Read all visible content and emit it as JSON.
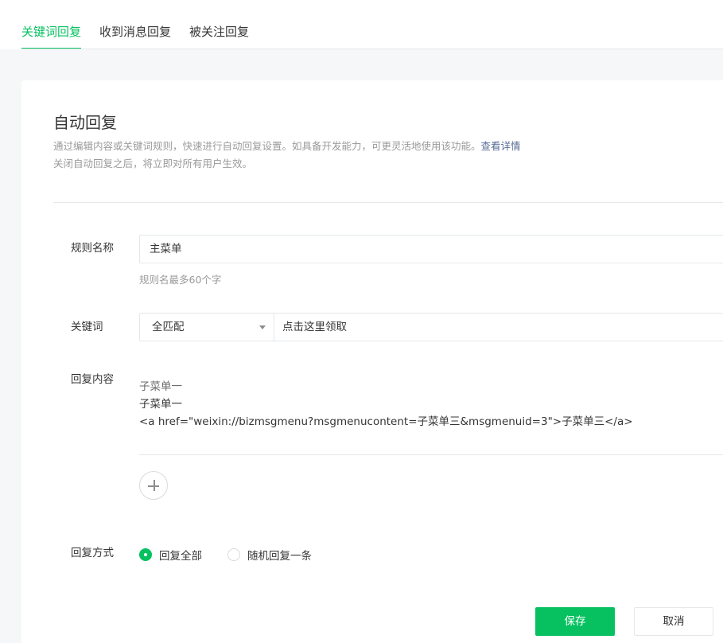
{
  "tabs": [
    {
      "label": "关键词回复",
      "active": true
    },
    {
      "label": "收到消息回复",
      "active": false
    },
    {
      "label": "被关注回复",
      "active": false
    }
  ],
  "section": {
    "title": "自动回复",
    "desc_line1": "通过编辑内容或关键词规则，快速进行自动回复设置。如具备开发能力，可更灵活地使用该功能。",
    "desc_link": "查看详情",
    "desc_line2": "关闭自动回复之后，将立即对所有用户生效。"
  },
  "form": {
    "rule_name_label": "规则名称",
    "rule_name_value": "主菜单",
    "rule_name_hint": "规则名最多60个字",
    "keyword_label": "关键词",
    "match_mode": "全匹配",
    "keyword_value": "点击这里领取",
    "reply_content_label": "回复内容",
    "reply_lines": [
      "子菜单一",
      "子菜单一",
      "<a href=\"weixin://bizmsgmenu?msgmenucontent=子菜单三&msgmenuid=3\">子菜单三</a>"
    ],
    "reply_mode_label": "回复方式",
    "reply_mode_options": [
      {
        "label": "回复全部",
        "checked": true
      },
      {
        "label": "随机回复一条",
        "checked": false
      }
    ]
  },
  "buttons": {
    "save": "保存",
    "cancel": "取消"
  },
  "colors": {
    "accent": "#07c160",
    "link": "#576b95"
  }
}
